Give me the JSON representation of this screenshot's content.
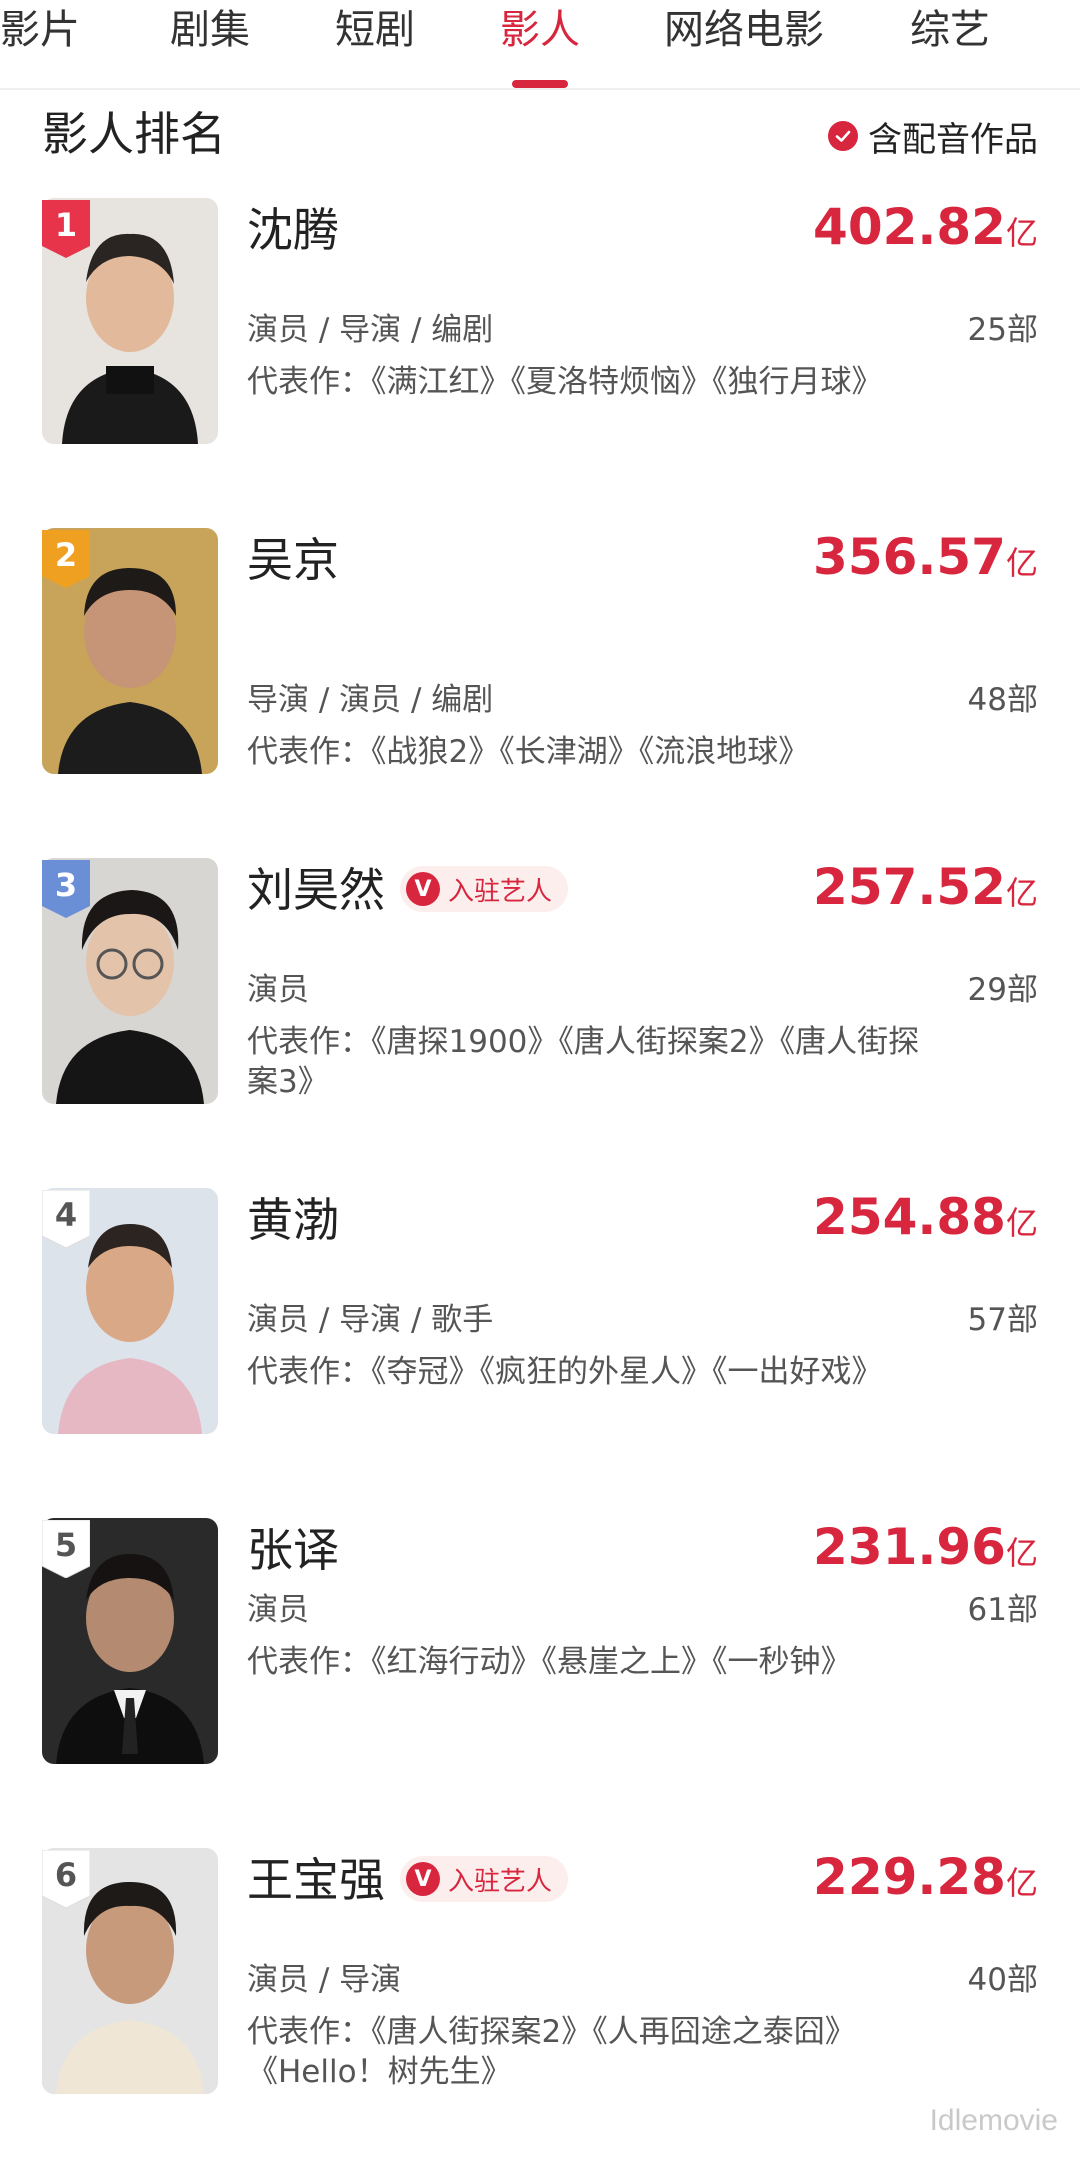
{
  "tabs": [
    {
      "label": "影片",
      "active": false
    },
    {
      "label": "剧集",
      "active": false
    },
    {
      "label": "短剧",
      "active": false
    },
    {
      "label": "影人",
      "active": true
    },
    {
      "label": "网络电影",
      "active": false
    },
    {
      "label": "综艺",
      "active": false
    }
  ],
  "section": {
    "title": "影人排名",
    "filter_label": "含配音作品",
    "filter_checked": true
  },
  "colors": {
    "accent": "#d7263d",
    "rank1": "#e8344a",
    "rank2": "#f0a020",
    "rank3": "#6b8fd6",
    "rank_plain": "#ffffff"
  },
  "people": [
    {
      "rank": "1",
      "name": "沈腾",
      "box_value": "402.82",
      "box_unit": "亿",
      "roles": "演员 / 导演 / 编剧",
      "works_count": "25部",
      "representative": "代表作：《满江红》《夏洛特烦恼》《独行月球》",
      "verified": false,
      "badge": ""
    },
    {
      "rank": "2",
      "name": "吴京",
      "box_value": "356.57",
      "box_unit": "亿",
      "roles": "导演 / 演员 / 编剧",
      "works_count": "48部",
      "representative": "代表作：《战狼2》《长津湖》《流浪地球》",
      "verified": false,
      "badge": ""
    },
    {
      "rank": "3",
      "name": "刘昊然",
      "box_value": "257.52",
      "box_unit": "亿",
      "roles": "演员",
      "works_count": "29部",
      "representative": "代表作：《唐探1900》《唐人街探案2》《唐人街探案3》",
      "verified": true,
      "badge": "入驻艺人"
    },
    {
      "rank": "4",
      "name": "黄渤",
      "box_value": "254.88",
      "box_unit": "亿",
      "roles": "演员 / 导演 / 歌手",
      "works_count": "57部",
      "representative": "代表作：《夺冠》《疯狂的外星人》《一出好戏》",
      "verified": false,
      "badge": ""
    },
    {
      "rank": "5",
      "name": "张译",
      "box_value": "231.96",
      "box_unit": "亿",
      "roles": "演员",
      "works_count": "61部",
      "representative": "代表作：《红海行动》《悬崖之上》《一秒钟》",
      "verified": false,
      "badge": ""
    },
    {
      "rank": "6",
      "name": "王宝强",
      "box_value": "229.28",
      "box_unit": "亿",
      "roles": "演员 / 导演",
      "works_count": "40部",
      "representative": "代表作：《唐人街探案2》《人再囧途之泰囧》《Hello！树先生》",
      "verified": true,
      "badge": "入驻艺人"
    }
  ],
  "watermark": "Idlemovie"
}
